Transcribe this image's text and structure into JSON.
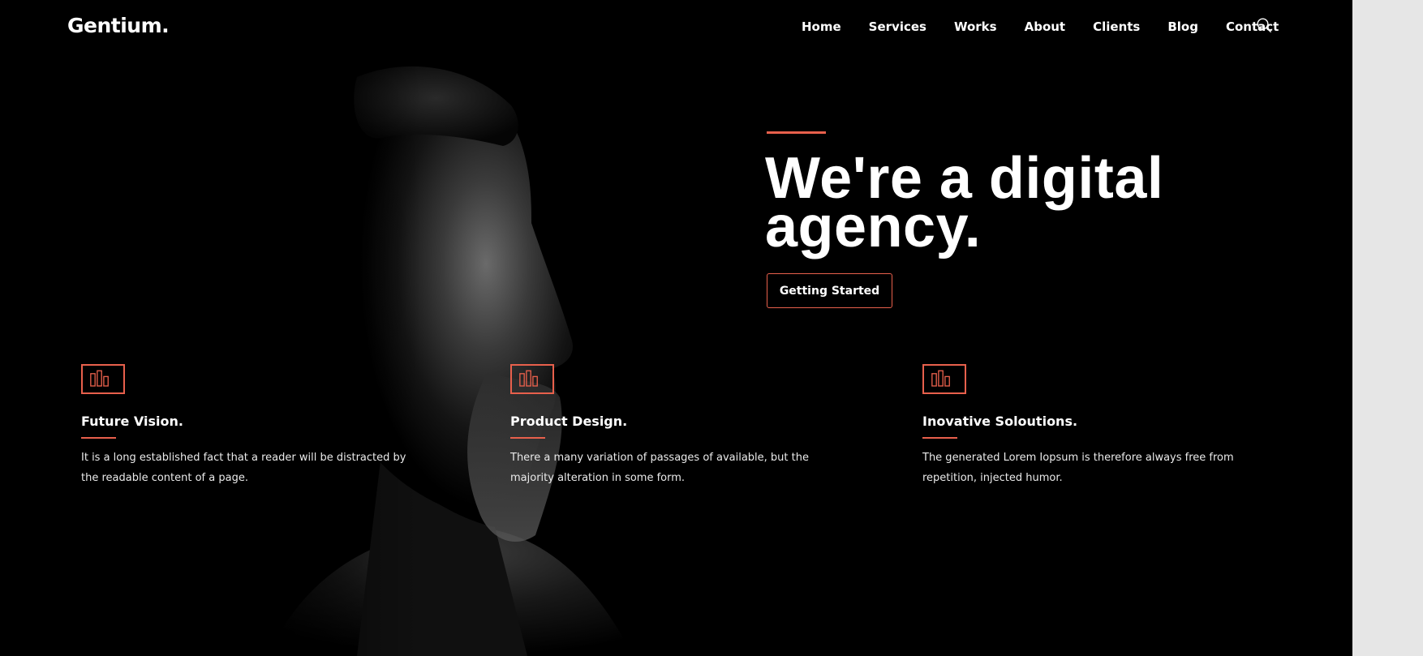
{
  "brand": "Gentium.",
  "nav": {
    "items": [
      "Home",
      "Services",
      "Works",
      "About",
      "Clients",
      "Blog",
      "Contact"
    ]
  },
  "icons": {
    "search": "search-icon",
    "feature": "bar-chart-icon"
  },
  "colors": {
    "accent": "#e8604c",
    "background": "#000000",
    "text": "#ffffff",
    "outside": "#e6e6e6"
  },
  "hero": {
    "title": "We're a digital agency.",
    "cta_label": "Getting Started"
  },
  "features": [
    {
      "title": "Future Vision.",
      "text": "It is a long established fact that a reader will be distracted by the readable content of a page."
    },
    {
      "title": "Product Design.",
      "text": "There a many variation of passages of available, but the majority alteration in some form."
    },
    {
      "title": "Inovative Soloutions.",
      "text": "The generated Lorem Iopsum is therefore always free from repetition, injected humor."
    }
  ]
}
